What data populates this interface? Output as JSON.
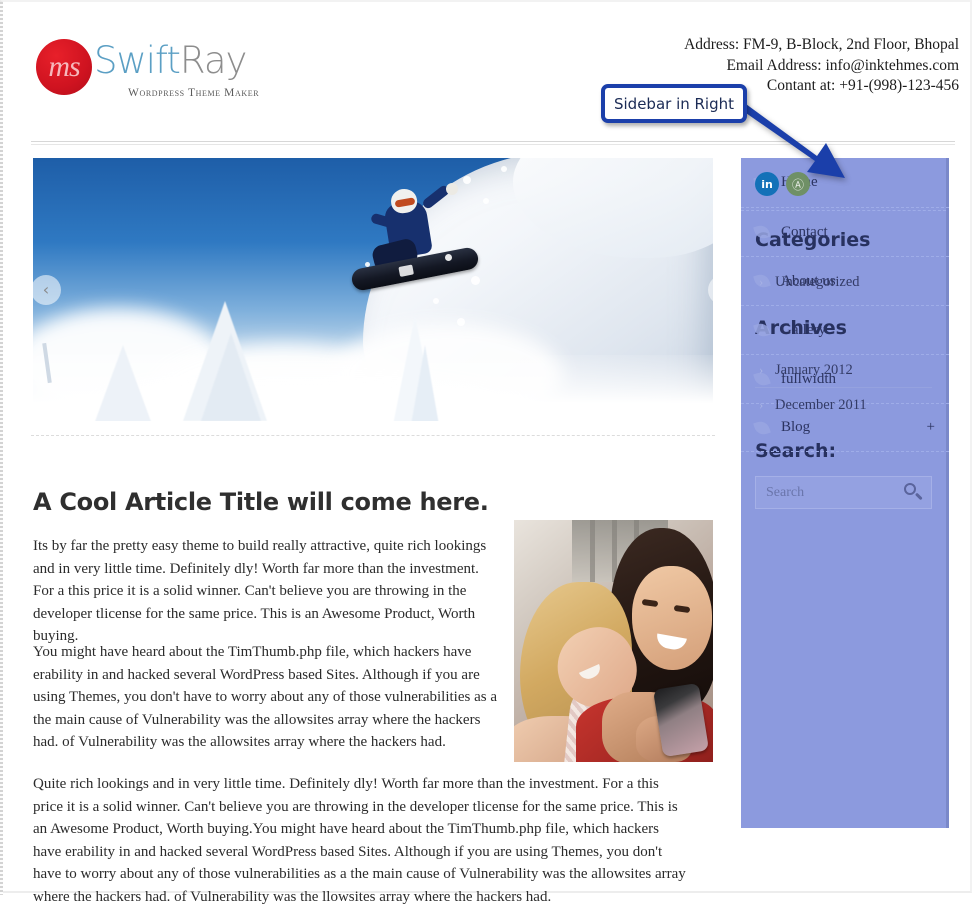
{
  "header": {
    "logo": {
      "mark_text": "ms",
      "name_part1": "Swift",
      "name_part2": "Ray",
      "tagline": "Wordpress Theme Maker"
    },
    "contact": {
      "address": "Address: FM-9, B-Block, 2nd Floor, Bhopal",
      "email": "Email Address: info@inktehmes.com",
      "phone": "Contant at: +91-(998)-123-456"
    }
  },
  "annotation": {
    "callout_label": "Sidebar in Right",
    "callout_border_color": "#1b3faa",
    "arrow_color": "#1b3faa"
  },
  "slider": {
    "prev_label": "‹",
    "next_label": "›",
    "image_alt": "Snowboarder jumping in deep powder snow against a blue sky"
  },
  "article": {
    "title": "A Cool Article Title will come here.",
    "image_alt": "Two smiling young women looking at a mobile phone",
    "paragraphs": [
      "Its by far the pretty easy theme to build really attractive, quite rich lookings and in very little time. Definitely dly! Worth far more than the investment. For a this price it is a solid winner. Can't believe you are throwing in the developer tlicense for the same price. This is an Awesome Product, Worth buying.",
      "You might have heard about the TimThumb.php file, which hackers have erability in and hacked several WordPress based Sites. Although if you are using Themes, you don't have to worry about any of those vulnerabilities as a the main cause of Vulnerability was the allowsites array where the hackers had. of Vulnerability was the allowsites array where the hackers had.",
      "Quite rich lookings and in very little time. Definitely dly! Worth far more than the investment. For a this price it is a solid winner. Can't believe you are throwing in the developer tlicense for the same price. This is an Awesome Product, Worth buying.You might have heard about the TimThumb.php file, which hackers have erability in and hacked several WordPress based Sites. Although if you are using Themes, you don't have to worry about any of those vulnerabilities as a the main cause of Vulnerability was the allowsites array where the hackers had. of Vulnerability was the llowsites array where the hackers had."
    ]
  },
  "sidebar": {
    "background_color": "#8c9ade",
    "menu": [
      {
        "label": "Home",
        "expander": ""
      },
      {
        "label": "Contact",
        "expander": ""
      },
      {
        "label": "About us",
        "expander": ""
      },
      {
        "label": "Gallery",
        "expander": ""
      },
      {
        "label": "fullwidth",
        "expander": ""
      },
      {
        "label": "Blog",
        "expander": "+"
      }
    ],
    "social": [
      {
        "name": "linkedin",
        "glyph": "in"
      },
      {
        "name": "tripadvisor",
        "glyph": "Ⓐ"
      }
    ],
    "categories": {
      "title": "Categories",
      "items": [
        "Uncategorized"
      ]
    },
    "archives": {
      "title": "Archives",
      "items": [
        "January 2012",
        "December 2011"
      ]
    },
    "search": {
      "title": "Search:",
      "placeholder": "Search",
      "value": ""
    }
  }
}
